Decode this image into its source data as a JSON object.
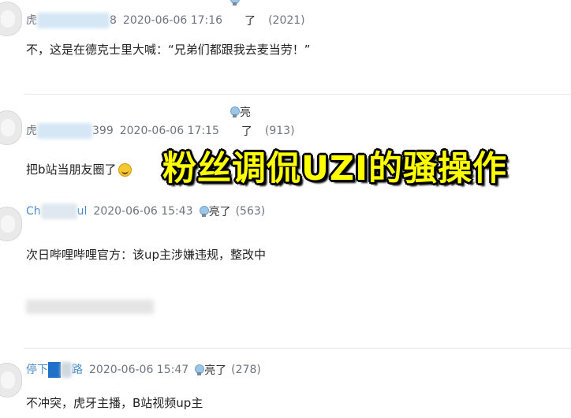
{
  "comments": [
    {
      "user_prefix": "虎",
      "user_suffix": "8",
      "time": "2020-06-06 17:16",
      "like_top": "",
      "like_label": "了",
      "likes": "(2021)",
      "text": "不，这是在德克士里大喊：“兄弟们都跟我去麦当劳！”"
    },
    {
      "user_prefix": "虎",
      "user_suffix": "399",
      "time": "2020-06-06 17:15",
      "like_top": "亮",
      "like_label": "了",
      "likes": "(913)",
      "text": "把b站当朋友圈了"
    },
    {
      "user_prefix": "Ch",
      "user_suffix": "ul",
      "time": "2020-06-06 15:43",
      "like_label": "亮了",
      "likes": "(563)",
      "text": "次日哔哩哔哩官方：该up主涉嫌违规，整改中"
    },
    {
      "user_prefix": "停下",
      "user_suffix": "路",
      "time": "2020-06-06 15:47",
      "like_label": "亮了",
      "likes": "(278)",
      "text": "不冲突，虎牙主播，B站视频up主"
    }
  ],
  "banner": "粉丝调侃UZI的骚操作",
  "colors": {
    "banner_fill": "#ffff00",
    "banner_stroke": "#000000",
    "meta_gray": "#6d7580",
    "divider": "#e5e9ef"
  },
  "icons": [
    "avatar",
    "lightbulb-icon",
    "smile-emoji-icon"
  ]
}
